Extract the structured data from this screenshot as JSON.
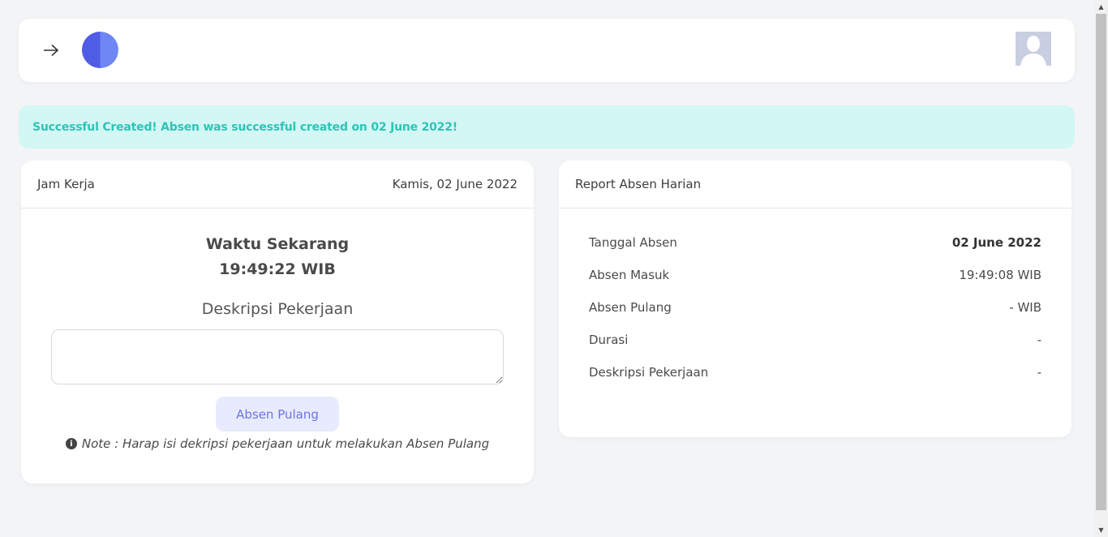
{
  "topbar": {
    "nav_icon": "arrow-right-icon",
    "logo_icon": "half-circle-logo",
    "avatar_icon": "user-avatar-icon",
    "colors": {
      "logo_left": "#4f5de4",
      "logo_right": "#6f86f5",
      "avatar_bg": "#c7cfe0"
    }
  },
  "alert": {
    "text": "Successful Created! Absen was successful created on 02 June 2022!"
  },
  "jam_kerja": {
    "title": "Jam Kerja",
    "date": "Kamis, 02 June 2022",
    "waktu_label": "Waktu Sekarang",
    "waktu_value": "19:49:22 WIB",
    "deskripsi_label": "Deskripsi Pekerjaan",
    "deskripsi_value": "",
    "button_label": "Absen Pulang",
    "note": "Note : Harap isi dekripsi pekerjaan untuk melakukan Absen Pulang"
  },
  "report": {
    "title": "Report Absen Harian",
    "rows": [
      {
        "label": "Tanggal Absen",
        "value": "02 June 2022"
      },
      {
        "label": "Absen Masuk",
        "value": "19:49:08 WIB"
      },
      {
        "label": "Absen Pulang",
        "value": "- WIB"
      },
      {
        "label": "Durasi",
        "value": "-"
      },
      {
        "label": "Deskripsi Pekerjaan",
        "value": "-"
      }
    ]
  },
  "colors": {
    "alert_bg": "#d2f7f5",
    "alert_text": "#2ec4b6",
    "button_bg": "#e8ebfd",
    "button_text": "#6b74e3",
    "page_bg": "#f3f4f6"
  }
}
